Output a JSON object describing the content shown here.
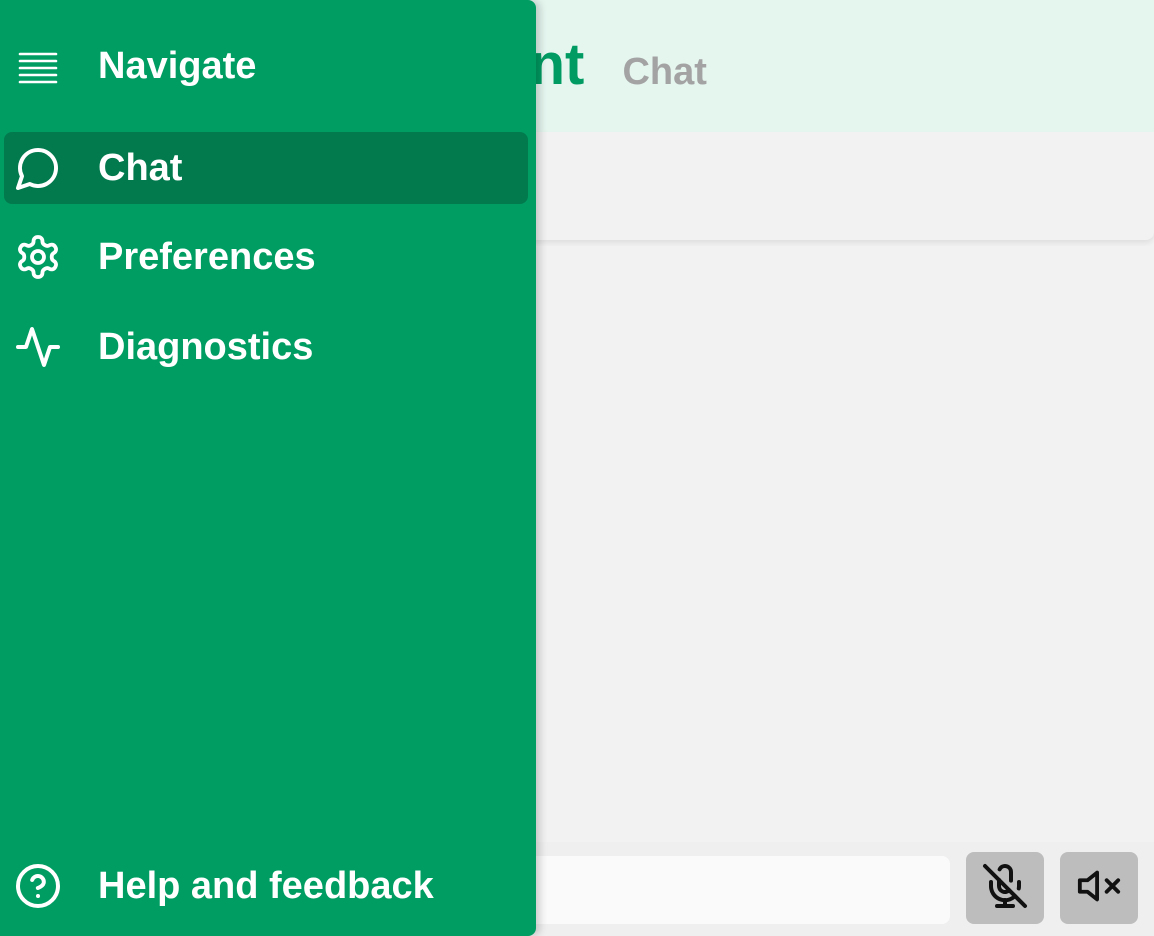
{
  "app": {
    "title": "Agent",
    "subtitle": "Chat",
    "accent_color": "#009d63",
    "header_bg": "#e5f6ef"
  },
  "drawer": {
    "header": {
      "icon": "menu-icon",
      "label": "Navigate"
    },
    "items": [
      {
        "icon": "chat-bubble-icon",
        "label": "Chat",
        "active": true
      },
      {
        "icon": "gear-icon",
        "label": "Preferences",
        "active": false
      },
      {
        "icon": "activity-icon",
        "label": "Diagnostics",
        "active": false
      }
    ],
    "footer": {
      "icon": "help-circle-icon",
      "label": "Help and feedback"
    }
  },
  "composer": {
    "input_value": "",
    "input_placeholder": "",
    "mic_button": {
      "icon": "mic-off-icon",
      "state": "muted"
    },
    "speaker_button": {
      "icon": "volume-off-icon",
      "state": "muted"
    }
  }
}
